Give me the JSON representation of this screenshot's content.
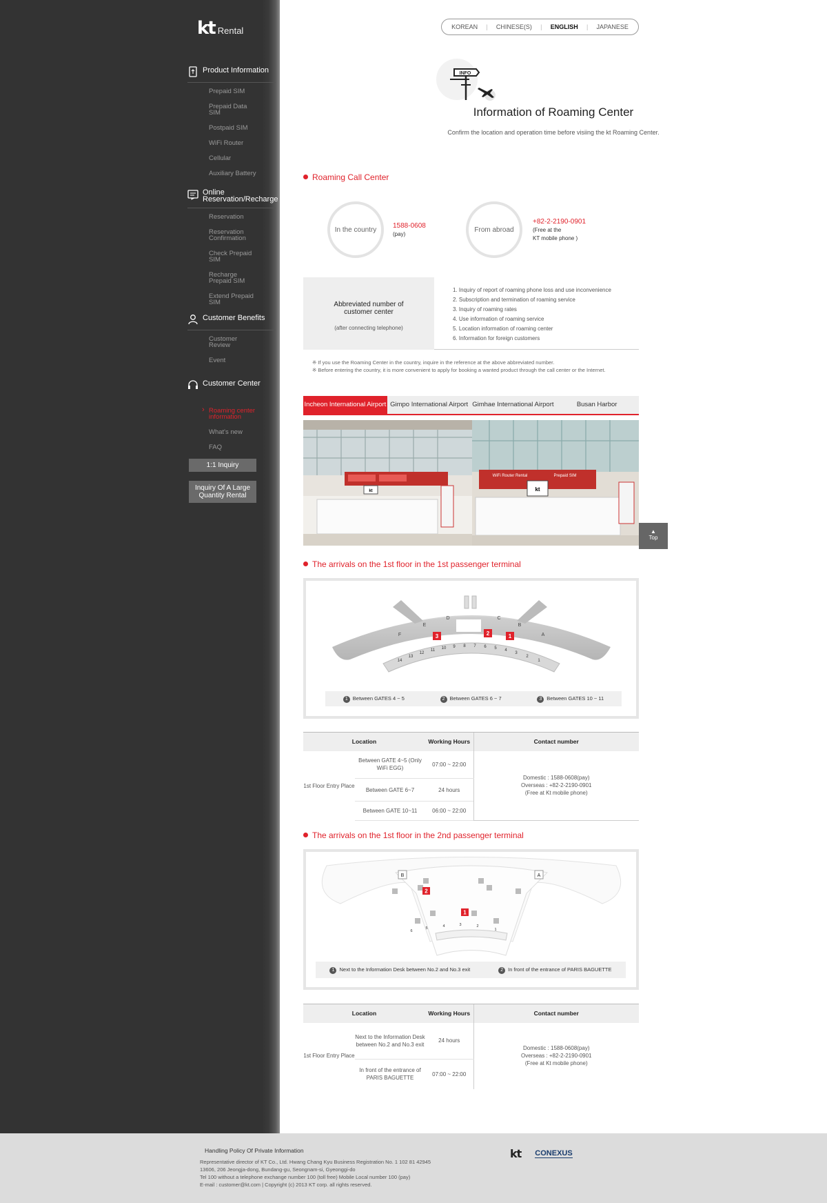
{
  "brand": {
    "logo": "kt",
    "product": "Rental"
  },
  "sidebar": {
    "groups": [
      {
        "title": "Product Information",
        "icon": "phone-icon",
        "items": [
          "Prepaid SIM",
          "Prepaid Data SIM",
          "Postpaid SIM",
          "WiFi Router",
          "Cellular",
          "Auxiliary Battery"
        ]
      },
      {
        "title": "Online Reservation/Recharge",
        "icon": "reservation-icon",
        "items": [
          "Reservation",
          "Reservation Confirmation",
          "Check Prepaid SIM",
          "Recharge Prepaid SIM",
          "Extend Prepaid SIM"
        ]
      },
      {
        "title": "Customer Benefits",
        "icon": "user-icon",
        "items": [
          "Customer Review",
          "Event"
        ]
      },
      {
        "title": "Customer Center",
        "icon": "headset-icon",
        "items": [
          "Roaming center information",
          "What's new",
          "FAQ"
        ]
      }
    ],
    "buttons": [
      "1:1 Inquiry",
      "Inquiry Of A Large Quantity Rental"
    ]
  },
  "languages": [
    "KOREAN",
    "CHINESE(S)",
    "ENGLISH",
    "JAPANESE"
  ],
  "selected_language": "ENGLISH",
  "hero": {
    "sign_text": "INFO"
  },
  "page": {
    "title": "Information of Roaming Center",
    "subtitle": "Confirm the location and operation time before visiing the kt Roaming Center."
  },
  "call_center": {
    "title": "Roaming Call Center",
    "domestic": {
      "label": "In the country",
      "number": "1588-0608",
      "note": "(pay)"
    },
    "abroad": {
      "label": "From abroad",
      "number": "+82-2-2190-0901",
      "note_line1": "(Free at the",
      "note_line2": "KT mobile phone )"
    },
    "abbr_title_line1": "Abbreviated number of",
    "abbr_title_line2": "customer center",
    "abbr_sub": "(after connecting telephone)",
    "services": [
      "1.  Inquiry of report of roaming phone loss and use inconvenience",
      "2.  Subscription and termination of roaming service",
      "3.  Inquiry of roaming rates",
      "4.  Use information of roaming service",
      "5.  Location information of roaming center",
      "6.  Information for foreign customers"
    ],
    "note1": "※ If you use the Roaming Center in the country, inquire in the reference at the above abbreviated number.",
    "note2": "※ Before entering the country, it is more convenient to apply for booking a wanted product through the call center or the Internet."
  },
  "tabs": [
    "Incheon International Airport",
    "Gimpo International Airport",
    "Gimhae International Airport",
    "Busan Harbor"
  ],
  "selected_tab": "Incheon International Airport",
  "photo": {
    "sign1": "WiFi Router Rental",
    "sign2": "Prepaid SIM",
    "kt_label": "kt"
  },
  "top_button": "Top",
  "terminal1": {
    "title": "The arrivals on the 1st floor in the 1st passenger terminal",
    "zones": [
      "A",
      "B",
      "C",
      "D",
      "E",
      "F"
    ],
    "gates": [
      "1",
      "2",
      "3",
      "4",
      "5",
      "6",
      "7",
      "8",
      "9",
      "10",
      "11",
      "12",
      "13",
      "14"
    ],
    "markers": [
      "1",
      "2",
      "3"
    ],
    "legend": [
      {
        "n": "1",
        "text": "Between GATES 4 ~ 5"
      },
      {
        "n": "2",
        "text": "Between GATES 6 ~ 7"
      },
      {
        "n": "3",
        "text": "Between GATES 10 ~ 11"
      }
    ],
    "table": {
      "headers": [
        "Location",
        "Working Hours",
        "Contact number"
      ],
      "place": "1st Floor Entry Place",
      "rows": [
        {
          "spot": "Between GATE 4~5 (Only WiFi EGG)",
          "hours": "07:00 ~ 22:00"
        },
        {
          "spot": "Between GATE 6~7",
          "hours": "24 hours"
        },
        {
          "spot": "Between GATE 10~11",
          "hours": "06:00 ~ 22:00"
        }
      ],
      "contact_line1": "Domestic : 1588-0608(pay)",
      "contact_line2": "Overseas : +82-2-2190-0901",
      "contact_line3": "(Free at Kt mobile phone)"
    }
  },
  "terminal2": {
    "title": "The arrivals on the 1st floor in the 2nd passenger terminal",
    "zones": [
      "A",
      "B"
    ],
    "markers": [
      "1",
      "2"
    ],
    "gates": [
      "1",
      "2",
      "3",
      "4",
      "5",
      "6"
    ],
    "legend": [
      {
        "n": "1",
        "text": "Next to the Information Desk between No.2 and No.3 exit"
      },
      {
        "n": "2",
        "text": "In front of the entrance of PARIS BAGUETTE"
      }
    ],
    "table": {
      "headers": [
        "Location",
        "Working Hours",
        "Contact number"
      ],
      "place": "1st Floor Entry Place",
      "rows": [
        {
          "spot": "Next to the Information Desk between No.2 and No.3 exit",
          "hours": "24 hours"
        },
        {
          "spot": "In front of the entrance of PARIS BAGUETTE",
          "hours": "07:00 ~ 22:00"
        }
      ],
      "contact_line1": "Domestic : 1588-0608(pay)",
      "contact_line2": "Overseas : +82-2-2190-0901",
      "contact_line3": "(Free at Kt mobile phone)"
    }
  },
  "footer": {
    "policy": "Handling Policy Of Private Information",
    "line1": "Representative director of KT Co., Ltd. Hwang Chang Kyu    Business Registration No. 1 102 81 42945",
    "line2": "13606, 206 Jeongja-dong, Bundang-gu, Seongnam-si, Gyeonggi-do",
    "line3": "Tel 100 without a telephone exchange number 100 (toll free)    Mobile Local number 100 (pay)",
    "line4": "E-mail : customer@kt.com  |  Copyright (c) 2013 KT corp. all rights reserved.",
    "logo_kt": "kt",
    "logo_partner": "CONEXUS"
  }
}
